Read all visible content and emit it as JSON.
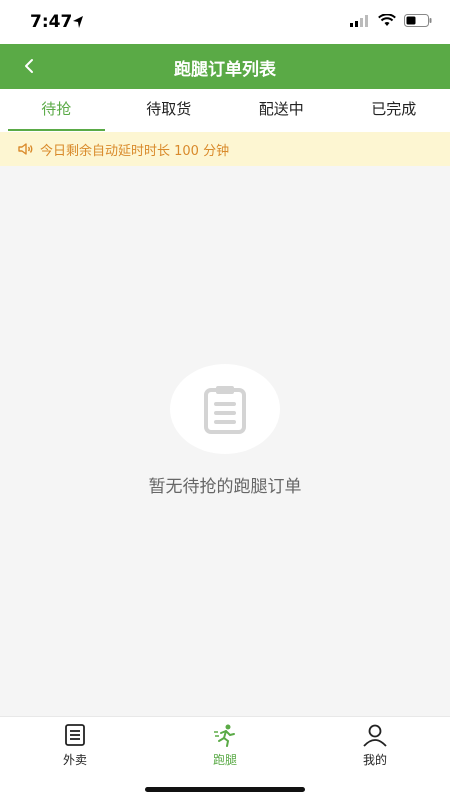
{
  "status_bar": {
    "time": "7:47"
  },
  "nav": {
    "title": "跑腿订单列表"
  },
  "tabs": [
    {
      "label": "待抢",
      "active": true
    },
    {
      "label": "待取货",
      "active": false
    },
    {
      "label": "配送中",
      "active": false
    },
    {
      "label": "已完成",
      "active": false
    }
  ],
  "notice": {
    "text": "今日剩余自动延时时长 100 分钟",
    "icon": "speaker-icon"
  },
  "empty_state": {
    "text": "暂无待抢的跑腿订单",
    "icon": "clipboard-icon"
  },
  "tabbar": [
    {
      "label": "外卖",
      "icon": "list-icon",
      "active": false
    },
    {
      "label": "跑腿",
      "icon": "runner-icon",
      "active": true
    },
    {
      "label": "我的",
      "icon": "user-icon",
      "active": false
    }
  ],
  "colors": {
    "brand_green": "#5aaa46",
    "notice_bg": "#fdf6d2",
    "notice_text": "#d98a2b"
  }
}
